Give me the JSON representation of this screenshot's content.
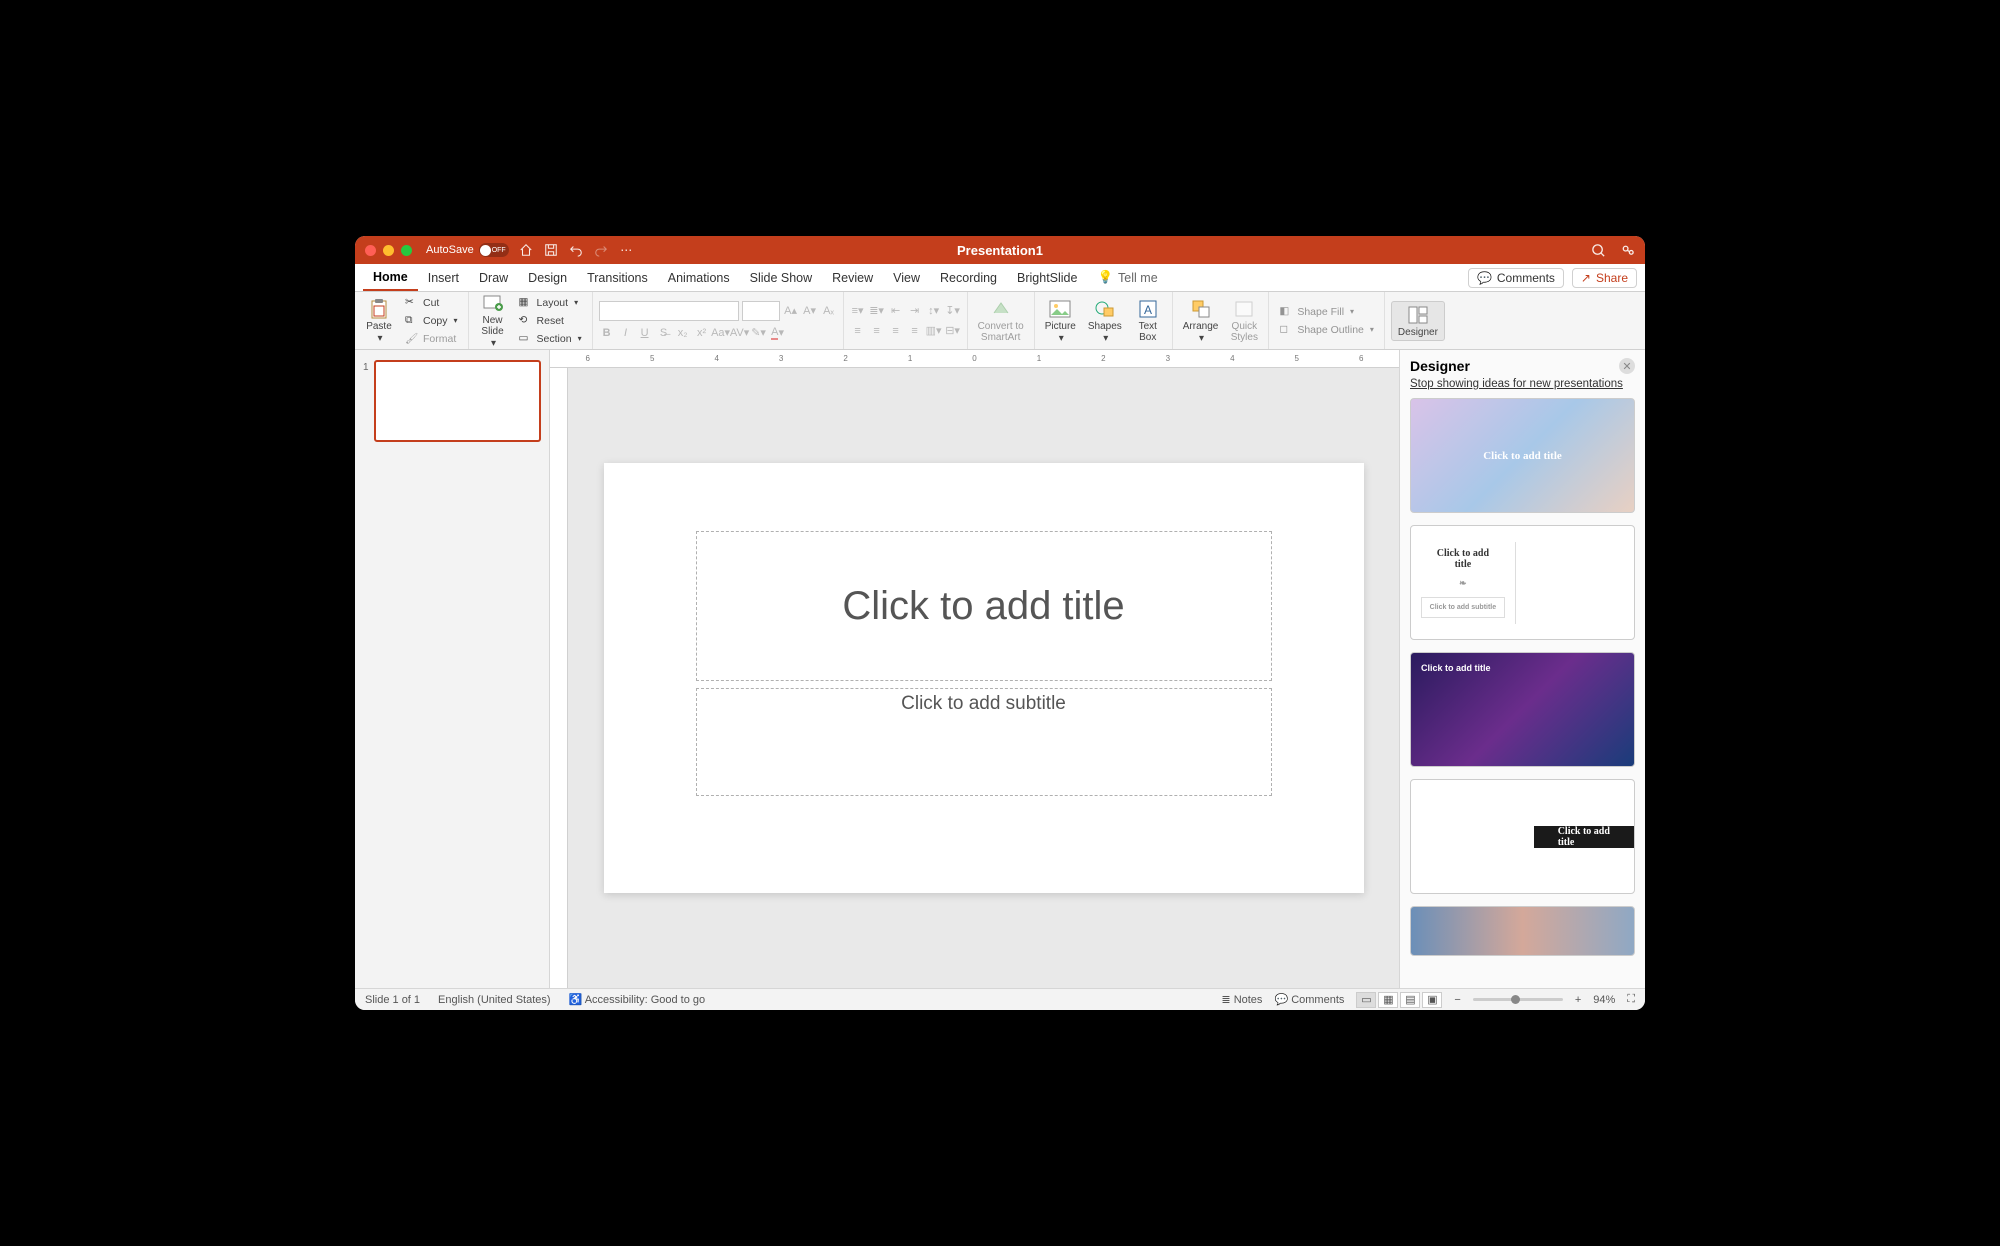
{
  "titlebar": {
    "autosave_label": "AutoSave",
    "autosave_state": "OFF",
    "title": "Presentation1"
  },
  "tabs": {
    "items": [
      "Home",
      "Insert",
      "Draw",
      "Design",
      "Transitions",
      "Animations",
      "Slide Show",
      "Review",
      "View",
      "Recording",
      "BrightSlide"
    ],
    "active": "Home",
    "tell_me": "Tell me",
    "comments": "Comments",
    "share": "Share"
  },
  "ribbon": {
    "paste": "Paste",
    "cut": "Cut",
    "copy": "Copy",
    "format": "Format",
    "new_slide": "New\nSlide",
    "layout": "Layout",
    "reset": "Reset",
    "section": "Section",
    "convert": "Convert to\nSmartArt",
    "picture": "Picture",
    "shapes": "Shapes",
    "textbox": "Text\nBox",
    "arrange": "Arrange",
    "quick": "Quick\nStyles",
    "shape_fill": "Shape Fill",
    "shape_outline": "Shape Outline",
    "designer": "Designer"
  },
  "thumbs": {
    "n1": "1"
  },
  "slide": {
    "title_ph": "Click to add title",
    "subtitle_ph": "Click to add subtitle"
  },
  "pane": {
    "title": "Designer",
    "stop_link": "Stop showing ideas for new presentations",
    "sg1_title": "Click to add title",
    "sg2_title": "Click to add\ntitle",
    "sg2_sub": "Click to add subtitle",
    "sg3_title": "Click to add title",
    "sg4_title": "Click to add\ntitle"
  },
  "status": {
    "slide": "Slide 1 of 1",
    "lang": "English (United States)",
    "access": "Accessibility: Good to go",
    "notes": "Notes",
    "comments": "Comments",
    "zoom": "94%"
  },
  "ruler": {
    "marks": [
      "6",
      "5",
      "4",
      "3",
      "2",
      "1",
      "0",
      "1",
      "2",
      "3",
      "4",
      "5",
      "6"
    ]
  }
}
